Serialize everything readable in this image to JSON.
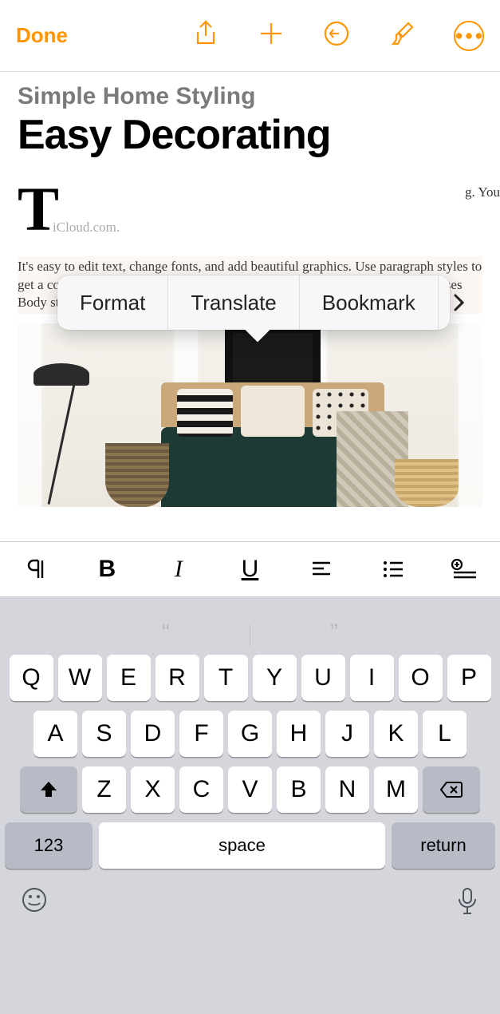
{
  "toolbar": {
    "done": "Done"
  },
  "document": {
    "subtitle": "Simple Home Styling",
    "title": "Easy Decorating",
    "dropcap": "T",
    "intro_visible_right": "g. You",
    "intro_cutoff": "iCloud.com.",
    "body": "It's easy to edit text, change fonts, and add beautiful graphics. Use paragraph styles to get a consistent look throughout your document. For example, this paragraph uses Body style. You can change it in the Text tab of the Format controls."
  },
  "popup": {
    "items": [
      "Format",
      "Translate",
      "Bookmark"
    ]
  },
  "format_bar": {
    "bold": "B",
    "italic": "I",
    "underline": "U"
  },
  "keyboard": {
    "row1": [
      "Q",
      "W",
      "E",
      "R",
      "T",
      "Y",
      "U",
      "I",
      "O",
      "P"
    ],
    "row2": [
      "A",
      "S",
      "D",
      "F",
      "G",
      "H",
      "J",
      "K",
      "L"
    ],
    "row3": [
      "Z",
      "X",
      "C",
      "V",
      "B",
      "N",
      "M"
    ],
    "numbers": "123",
    "space": "space",
    "return": "return",
    "quote_left": "“",
    "quote_right": "”"
  }
}
